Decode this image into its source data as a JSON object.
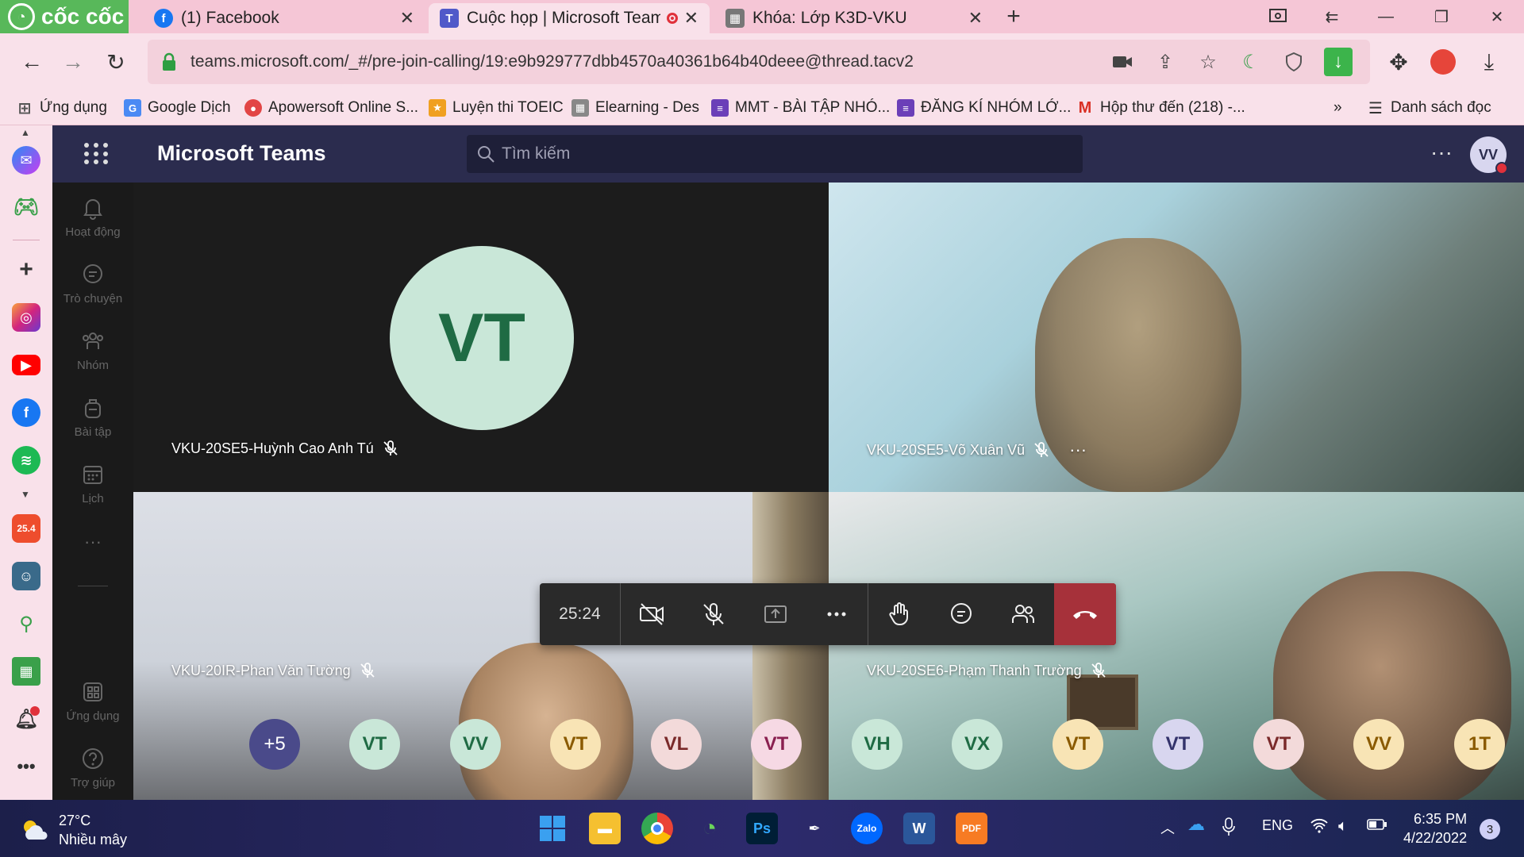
{
  "browser": {
    "brand": "cốc cốc",
    "tabs": [
      {
        "label": "(1) Facebook"
      },
      {
        "label": "Cuộc họp | Microsoft Teams"
      },
      {
        "label": "Khóa: Lớp K3D-VKU"
      }
    ],
    "new_tab": "+",
    "url": "teams.microsoft.com/_#/pre-join-calling/19:e9b929777dbb4570a40361b64b40deee@thread.tacv2",
    "bookmarks": [
      {
        "label": "Ứng dụng"
      },
      {
        "label": "Google Dịch"
      },
      {
        "label": "Apowersoft Online S..."
      },
      {
        "label": "Luyện thi TOEIC"
      },
      {
        "label": "Elearning - Des"
      },
      {
        "label": "MMT - BÀI TẬP NHÓ..."
      },
      {
        "label": "ĐĂNG KÍ NHÓM LỚ..."
      },
      {
        "label": "Hộp thư đến (218) -..."
      }
    ],
    "bookmarks_overflow": "»",
    "reading_list": "Danh sách đọc",
    "side_badge": "25.4"
  },
  "teams": {
    "title": "Microsoft Teams",
    "search_placeholder": "Tìm kiếm",
    "user_initials": "VV",
    "rail": [
      {
        "label": "Hoạt động"
      },
      {
        "label": "Trò chuyện"
      },
      {
        "label": "Nhóm"
      },
      {
        "label": "Bài tập"
      },
      {
        "label": "Lịch"
      },
      {
        "label": "Ứng dụng"
      },
      {
        "label": "Trợ giúp"
      }
    ],
    "tiles": [
      {
        "name": "VKU-20SE5-Huỳnh Cao Anh Tú",
        "initials": "VT"
      },
      {
        "name": "VKU-20SE5-Võ Xuân Vũ"
      },
      {
        "name": "VKU-20IR-Phan Văn Tường"
      },
      {
        "name": "VKU-20SE6-Phạm Thanh Trường"
      }
    ],
    "timer": "25:24",
    "more_participants": "+5",
    "participants": [
      {
        "initials": "VT",
        "bg": "#c9e7d8",
        "fg": "#1f6b44"
      },
      {
        "initials": "VV",
        "bg": "#c9e7d8",
        "fg": "#1f6b44"
      },
      {
        "initials": "VT",
        "bg": "#f8e4b5",
        "fg": "#8a5a00"
      },
      {
        "initials": "VL",
        "bg": "#f3dada",
        "fg": "#7a2a2a"
      },
      {
        "initials": "VT",
        "bg": "#f6d9e4",
        "fg": "#8a2050"
      },
      {
        "initials": "VH",
        "bg": "#c9e7d8",
        "fg": "#1f6b44"
      },
      {
        "initials": "VX",
        "bg": "#c9e7d8",
        "fg": "#1f6b44"
      },
      {
        "initials": "VT",
        "bg": "#f8e4b5",
        "fg": "#8a5a00"
      },
      {
        "initials": "VT",
        "bg": "#d8d6ef",
        "fg": "#33336b"
      },
      {
        "initials": "VT",
        "bg": "#f3dada",
        "fg": "#7a2a2a"
      },
      {
        "initials": "VV",
        "bg": "#f8e4b5",
        "fg": "#8a5a00"
      },
      {
        "initials": "1T",
        "bg": "#f8e4b5",
        "fg": "#8a5a00"
      }
    ]
  },
  "taskbar": {
    "temperature": "27°C",
    "weather": "Nhiều mây",
    "language": "ENG",
    "time": "6:35 PM",
    "date": "4/22/2022",
    "notifications": "3"
  },
  "colors": {
    "teams_header": "#2b2c4e",
    "hangup": "#a6313a",
    "brand_green": "#58b85a"
  }
}
